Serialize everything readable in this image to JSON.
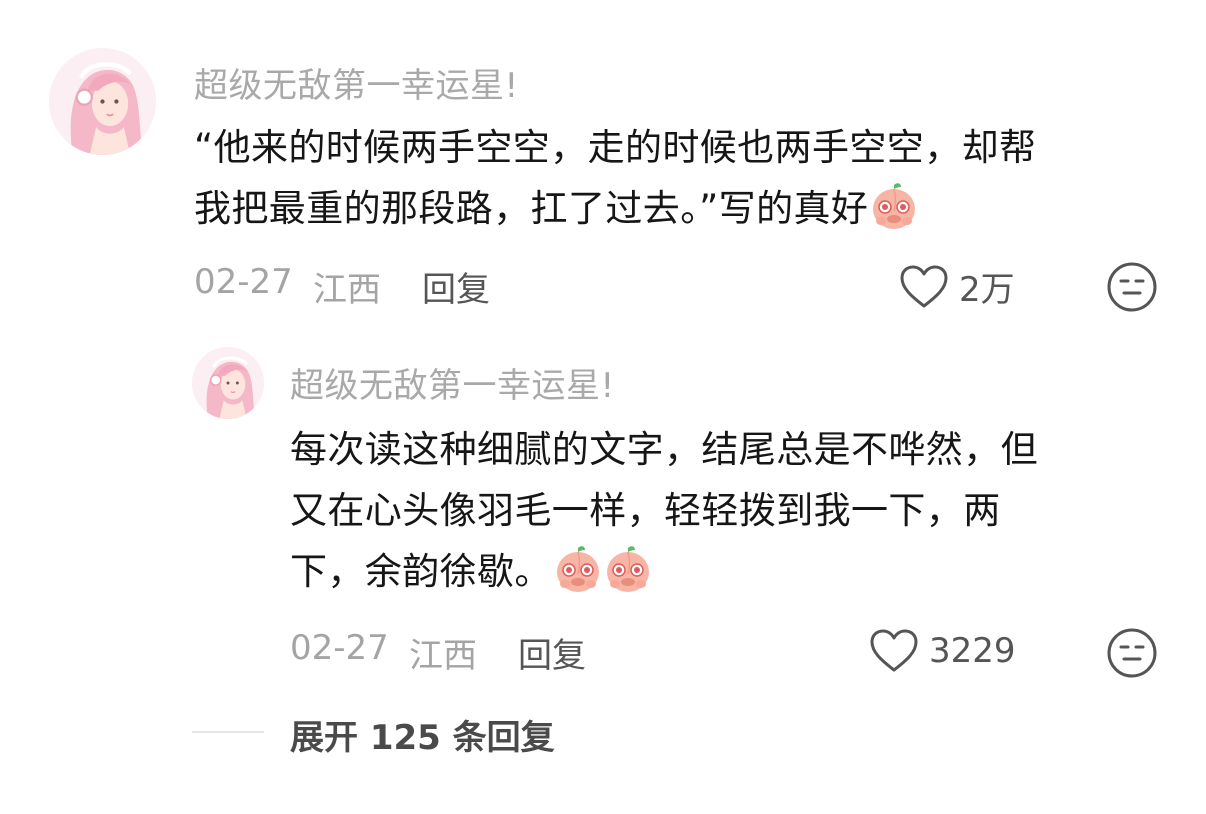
{
  "comment": {
    "username": "超级无敌第一幸运星!",
    "text_line1": "“他来的时候两手空空，走的时候也两手空空，却帮",
    "text_line2": "我把最重的那段路，扛了过去。”写的真好",
    "emoji": "peach-cry-emoji",
    "date": "02-27",
    "location": "江西",
    "reply_label": "回复",
    "like_count": "2万"
  },
  "reply": {
    "username": "超级无敌第一幸运星!",
    "text_line1": "每次读这种细腻的文字，结尾总是不哗然，但",
    "text_line2": "又在心头像羽毛一样，轻轻拨到我一下，两",
    "text_line3": "下，余韵徐歇。",
    "emoji": "peach-cry-emoji",
    "date": "02-27",
    "location": "江西",
    "reply_label": "回复",
    "like_count": "3229"
  },
  "expand": {
    "label": "展开 125 条回复"
  },
  "colors": {
    "username": "#a9a9a9",
    "text": "#161616",
    "meta": "#a4a4a4",
    "icon": "#555555"
  }
}
